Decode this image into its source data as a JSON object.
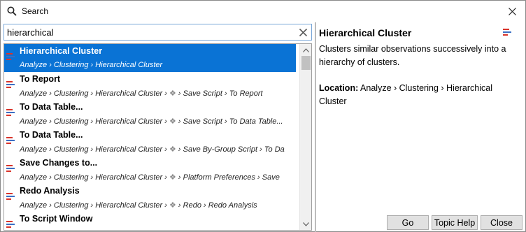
{
  "window": {
    "title": "Search"
  },
  "search": {
    "value": "hierarchical"
  },
  "results": [
    {
      "title": "Hierarchical Cluster",
      "path": [
        "Analyze",
        "Clustering",
        "Hierarchical Cluster"
      ],
      "selected": true
    },
    {
      "title": "To Report",
      "path": [
        "Analyze",
        "Clustering",
        "Hierarchical Cluster",
        "*",
        "Save Script",
        "To Report"
      ],
      "selected": false
    },
    {
      "title": "To Data Table...",
      "path": [
        "Analyze",
        "Clustering",
        "Hierarchical Cluster",
        "*",
        "Save Script",
        "To Data Table..."
      ],
      "selected": false
    },
    {
      "title": "To Data Table...",
      "path": [
        "Analyze",
        "Clustering",
        "Hierarchical Cluster",
        "*",
        "Save By-Group Script",
        "To Da"
      ],
      "selected": false
    },
    {
      "title": "Save Changes to...",
      "path": [
        "Analyze",
        "Clustering",
        "Hierarchical Cluster",
        "*",
        "Platform Preferences",
        "Save"
      ],
      "selected": false
    },
    {
      "title": "Redo Analysis",
      "path": [
        "Analyze",
        "Clustering",
        "Hierarchical Cluster",
        "*",
        "Redo",
        "Redo Analysis"
      ],
      "selected": false
    },
    {
      "title": "To Script Window",
      "path": [],
      "selected": false
    }
  ],
  "detail": {
    "title": "Hierarchical Cluster",
    "description": "Clusters similar observations successively into a hierarchy of clusters.",
    "location_label": "Location:",
    "location_value": "Analyze › Clustering › Hierarchical Cluster"
  },
  "buttons": {
    "go": "Go",
    "topic_help": "Topic Help",
    "close": "Close"
  },
  "colors": {
    "selection": "#0a73d5",
    "icon_red": "#d9342b",
    "icon_blue": "#3a6fc4"
  }
}
